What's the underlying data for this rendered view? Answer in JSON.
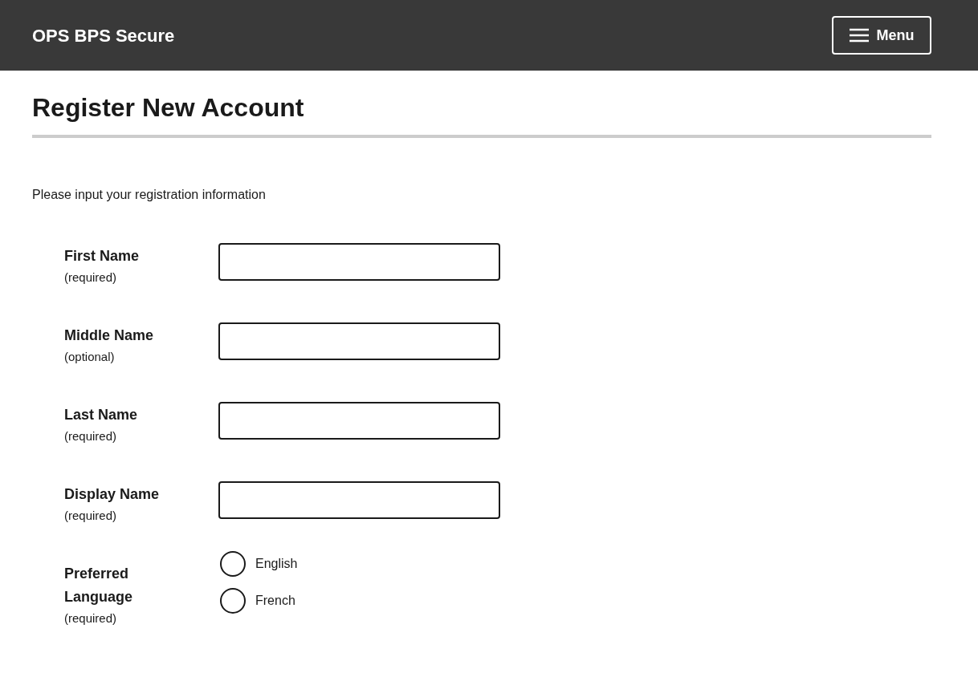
{
  "header": {
    "title": "OPS BPS Secure",
    "menu_button": "Menu"
  },
  "page": {
    "heading": "Register New Account",
    "intro": "Please input your registration information"
  },
  "fields": [
    {
      "kind": "text",
      "label": "First Name",
      "note": "(required)"
    },
    {
      "kind": "text",
      "label": "Middle Name",
      "note": "(optional)"
    },
    {
      "kind": "text",
      "label": "Last Name",
      "note": "(required)"
    },
    {
      "kind": "text",
      "label": "Display Name",
      "note": "(required)"
    },
    {
      "kind": "radio",
      "label": "Preferred Language",
      "note": "(required)",
      "options": [
        {
          "label": "English",
          "selected": false
        },
        {
          "label": "French",
          "selected": false
        }
      ]
    }
  ]
}
